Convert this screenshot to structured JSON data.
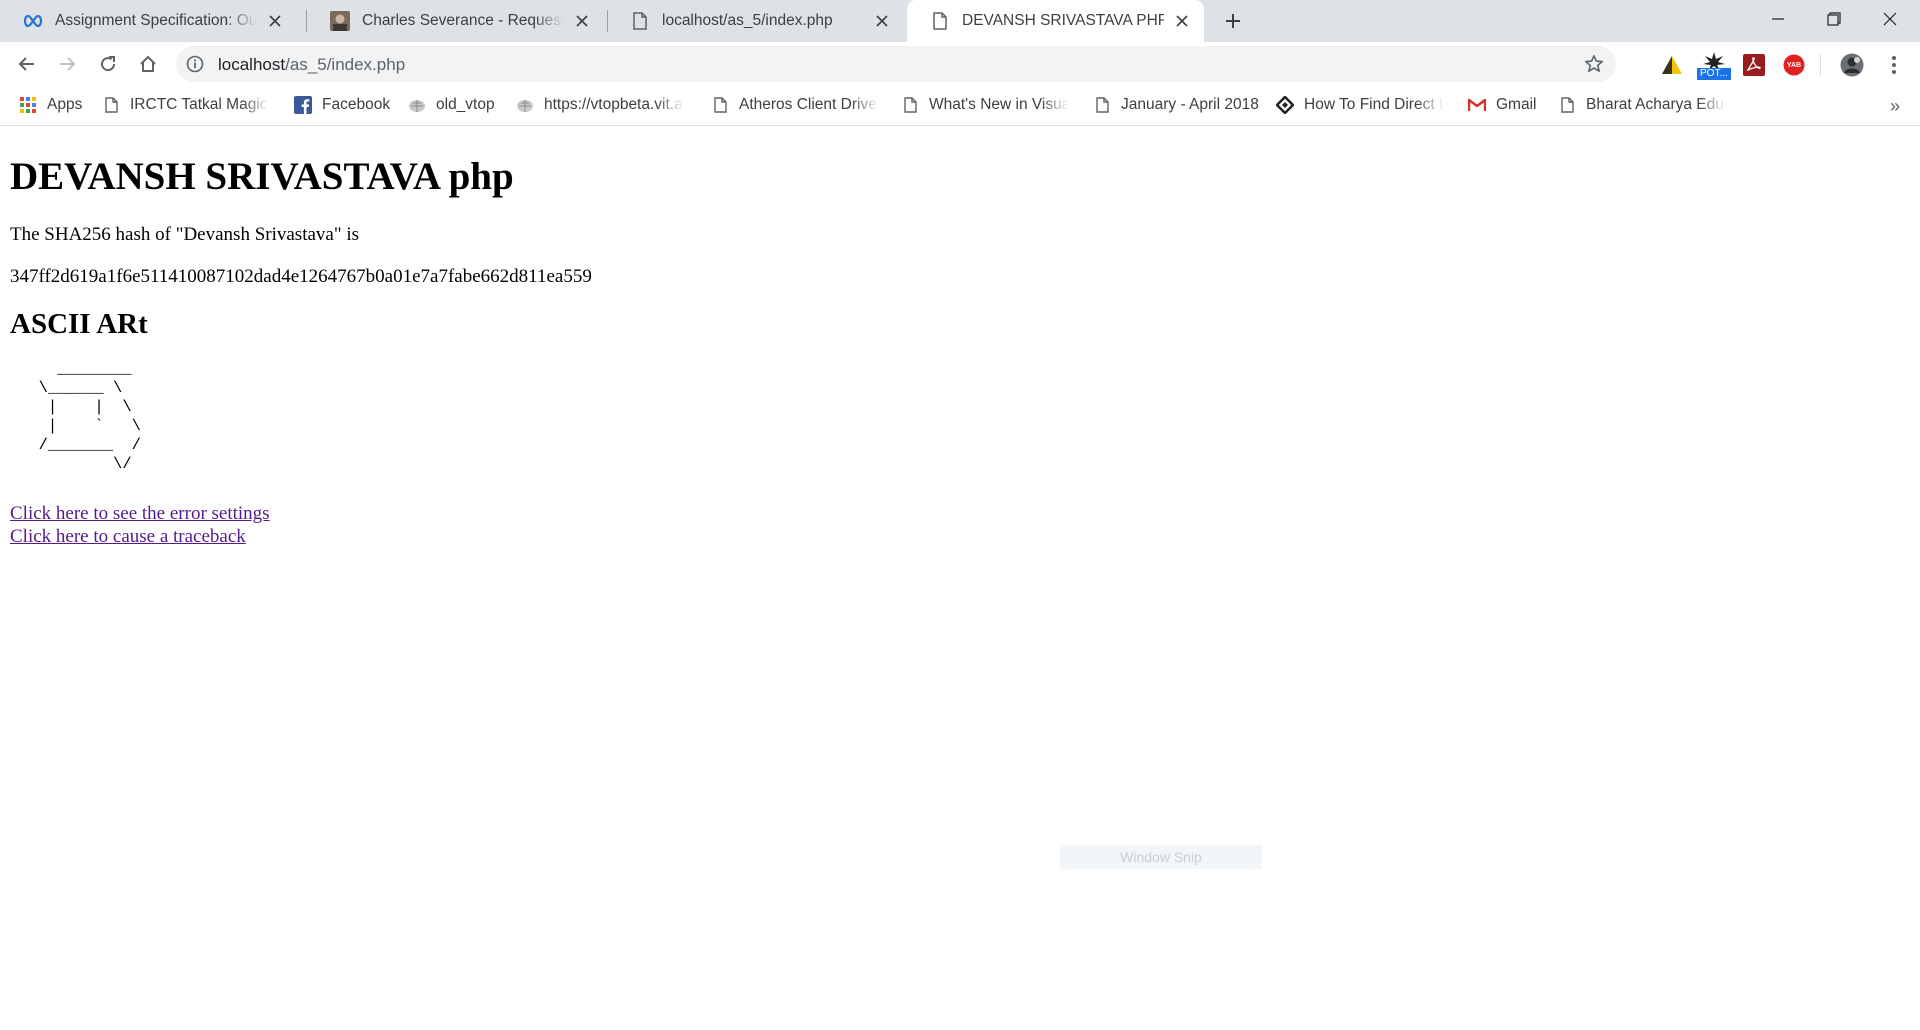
{
  "browser": {
    "tabs": [
      {
        "title": "Assignment Specification: Our Fi",
        "icon": "coursera-infinity-icon",
        "active": false
      },
      {
        "title": "Charles Severance - Request/Res",
        "icon": "photo-favicon",
        "active": false
      },
      {
        "title": "localhost/as_5/index.php",
        "icon": "page-icon",
        "active": false
      },
      {
        "title": "DEVANSH SRIVASTAVA PHP",
        "icon": "page-icon",
        "active": true
      }
    ],
    "address_bar": {
      "host": "localhost",
      "path": "/as_5/index.php"
    },
    "extensions": [
      "kiwi-extension-icon",
      "pot-extension-icon",
      "pdf-extension-icon",
      "yab-extension-icon",
      "profile-avatar"
    ],
    "extension_labels": {
      "pot": "POT...",
      "yab": "YAB"
    },
    "bookmarks": [
      {
        "label": "Apps",
        "icon": "apps-grid-icon"
      },
      {
        "label": "IRCTC Tatkal Magic A",
        "icon": "page-icon"
      },
      {
        "label": "Facebook",
        "icon": "facebook-icon"
      },
      {
        "label": "old_vtop",
        "icon": "vit-logo-icon"
      },
      {
        "label": "https://vtopbeta.vit.a",
        "icon": "vit-logo-icon"
      },
      {
        "label": "Atheros Client Driver",
        "icon": "page-icon"
      },
      {
        "label": "What's New in Visual",
        "icon": "page-icon"
      },
      {
        "label": "January - April 2018",
        "icon": "page-icon"
      },
      {
        "label": "How To Find Direct D",
        "icon": "diamond-logo-icon"
      },
      {
        "label": "Gmail",
        "icon": "gmail-icon"
      },
      {
        "label": "Bharat Acharya Educ",
        "icon": "page-icon"
      }
    ],
    "bookmarks_overflow": "»"
  },
  "page": {
    "heading": "DEVANSH SRIVASTAVA php",
    "hash_intro": "The SHA256 hash of \"Devansh Srivastava\" is",
    "hash_value": "347ff2d619a1f6e511410087102dad4e1264767b0a01e7a7fabe662d811ea559",
    "ascii_heading": "ASCII ARt",
    "ascii_art": "    ________\n  \\______ \\\n   |    |  \\\n   |    `   \\\n  /_______  /\n          \\/",
    "links": [
      {
        "label": "Click here to see the error settings"
      },
      {
        "label": "Click here to cause a traceback"
      }
    ]
  },
  "overlay": {
    "snip_label": "Window Snip"
  },
  "colors": {
    "tabstrip_bg": "#dee1e6",
    "omnibox_bg": "#f1f3f4",
    "visited_link": "#551a8b"
  }
}
